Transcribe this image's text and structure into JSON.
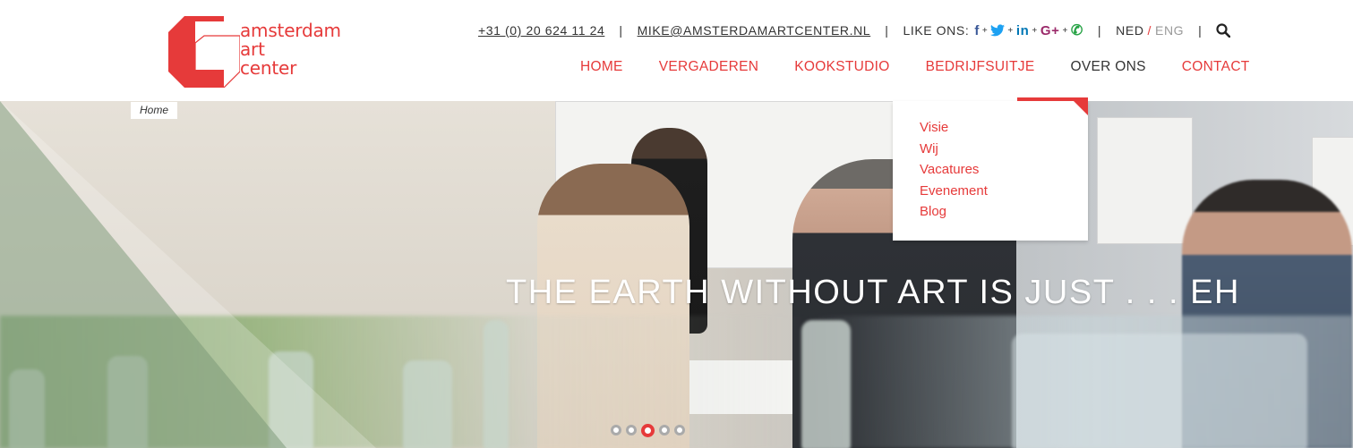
{
  "brand": {
    "logo_line1": "amsterdam",
    "logo_line2": "art",
    "logo_line3": "center",
    "accent_color": "#e63a3a"
  },
  "topbar": {
    "phone": "+31 (0) 20 624 11 24",
    "email": "MIKE@AMSTERDAMARTCENTER.NL",
    "like_label": "LIKE ONS:",
    "social_icons": [
      "facebook-icon",
      "twitter-icon",
      "linkedin-icon",
      "google-plus-icon",
      "whatsapp-icon"
    ],
    "facebook": "f",
    "twitter": "🐦",
    "linkedin": "in",
    "googleplus": "G+",
    "whatsapp": "✆",
    "lang_active": "NED",
    "lang_slash": "/",
    "lang_inactive": "ENG",
    "separator": "|",
    "search_icon": "search-icon"
  },
  "nav": {
    "items": [
      {
        "label": "HOME"
      },
      {
        "label": "VERGADEREN"
      },
      {
        "label": "KOOKSTUDIO"
      },
      {
        "label": "BEDRIJFSUITJE"
      },
      {
        "label": "OVER ONS"
      },
      {
        "label": "CONTACT"
      }
    ],
    "active": "OVER ONS"
  },
  "dropdown": {
    "items": [
      {
        "label": "Visie"
      },
      {
        "label": "Wij"
      },
      {
        "label": "Vacatures"
      },
      {
        "label": "Evenement"
      },
      {
        "label": "Blog"
      }
    ]
  },
  "breadcrumb": "Home",
  "hero": {
    "tagline": "THE EARTH WITHOUT ART IS JUST . . . EH",
    "slide_count": 5,
    "active_slide": 3
  }
}
